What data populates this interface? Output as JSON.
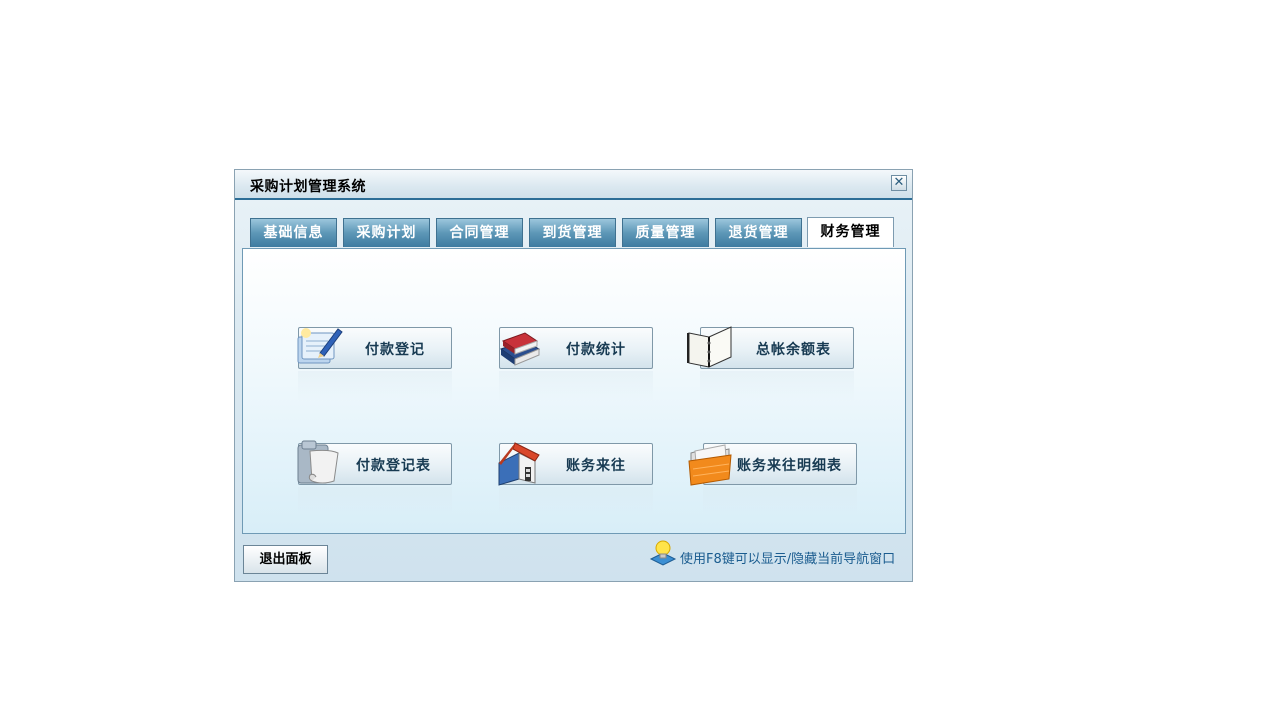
{
  "window": {
    "title": "采购计划管理系统"
  },
  "tabs": [
    {
      "label": "基础信息"
    },
    {
      "label": "采购计划"
    },
    {
      "label": "合同管理"
    },
    {
      "label": "到货管理"
    },
    {
      "label": "质量管理"
    },
    {
      "label": "退货管理"
    },
    {
      "label": "财务管理",
      "active": true
    }
  ],
  "items": [
    {
      "label": "付款登记",
      "icon": "pen-paper-icon"
    },
    {
      "label": "付款统计",
      "icon": "books-icon"
    },
    {
      "label": "总帐余额表",
      "icon": "binder-icon"
    },
    {
      "label": "付款登记表",
      "icon": "scroll-folder-icon"
    },
    {
      "label": "账务来往",
      "icon": "house-icon"
    },
    {
      "label": "账务来往明细表",
      "icon": "orange-folder-icon"
    }
  ],
  "footer": {
    "exit_label": "退出面板",
    "hint": "使用F8键可以显示/隐藏当前导航窗口"
  },
  "colors": {
    "tab": "#4f8bae",
    "title_border": "#2d6e97",
    "hint": "#1a5c8f"
  }
}
